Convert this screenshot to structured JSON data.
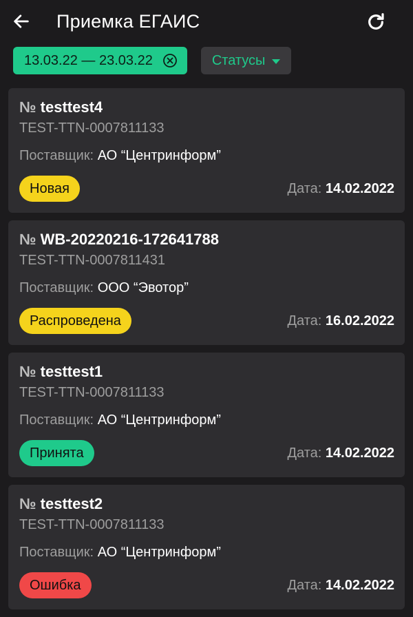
{
  "header": {
    "title": "Приемка ЕГАИС",
    "back_icon": "arrow-left-icon",
    "refresh_icon": "refresh-icon"
  },
  "filters": {
    "date_range": "13.03.22 — 23.03.22",
    "clear_icon": "clear-circle-icon",
    "status_label": "Статусы",
    "status_icon": "caret-down-icon"
  },
  "labels": {
    "supplier": "Поставщик:",
    "date": "Дата:",
    "number_symbol": "№"
  },
  "colors": {
    "accent": "#1fca8b",
    "new": "#f5d31c",
    "posted": "#f5d31c",
    "accepted": "#1fca8b",
    "error": "#f04848"
  },
  "documents": [
    {
      "number": "testtest4",
      "ttn": "TEST-TTN-0007811133",
      "supplier": "АО “Центринформ”",
      "status": "Новая",
      "status_color": "#f5d31c",
      "date": "14.02.2022"
    },
    {
      "number": "WB-20220216-172641788",
      "ttn": "TEST-TTN-0007811431",
      "supplier": "ООО “Эвотор”",
      "status": "Распроведена",
      "status_color": "#f5d31c",
      "date": "16.02.2022"
    },
    {
      "number": "testtest1",
      "ttn": "TEST-TTN-0007811133",
      "supplier": "АО “Центринформ”",
      "status": "Принята",
      "status_color": "#1fca8b",
      "date": "14.02.2022"
    },
    {
      "number": "testtest2",
      "ttn": "TEST-TTN-0007811133",
      "supplier": "АО “Центринформ”",
      "status": "Ошибка",
      "status_color": "#f04848",
      "date": "14.02.2022"
    }
  ]
}
